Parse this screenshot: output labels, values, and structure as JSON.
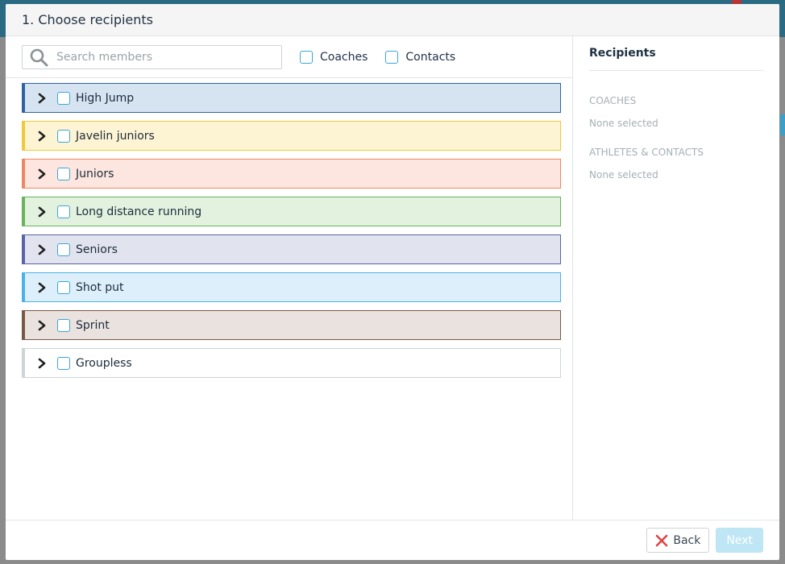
{
  "modal": {
    "title": "1. Choose recipients"
  },
  "search": {
    "placeholder": "Search members",
    "value": ""
  },
  "filters": {
    "coaches_label": "Coaches",
    "contacts_label": "Contacts"
  },
  "groups": [
    {
      "label": "High Jump",
      "bg": "#d6e4f2",
      "border": "#2f62a5"
    },
    {
      "label": "Javelin juniors",
      "bg": "#fdf4d3",
      "border": "#f0c93a"
    },
    {
      "label": "Juniors",
      "bg": "#fde6df",
      "border": "#ef8663"
    },
    {
      "label": "Long distance running",
      "bg": "#e2f2de",
      "border": "#68b35c"
    },
    {
      "label": "Seniors",
      "bg": "#e1e3ee",
      "border": "#5a62a8"
    },
    {
      "label": "Shot put",
      "bg": "#dceffb",
      "border": "#4ab2e6"
    },
    {
      "label": "Sprint",
      "bg": "#e9e2df",
      "border": "#7a5848"
    },
    {
      "label": "Groupless",
      "bg": "#ffffff",
      "border": "#cfd4d8"
    }
  ],
  "recipients": {
    "title": "Recipients",
    "coaches_heading": "COACHES",
    "coaches_empty": "None selected",
    "athletes_heading": "ATHLETES & CONTACTS",
    "athletes_empty": "None selected"
  },
  "footer": {
    "back_label": "Back",
    "next_label": "Next"
  },
  "icons": {
    "search": "search-icon",
    "chevron": "chevron-right-icon",
    "back": "close-x-icon"
  }
}
